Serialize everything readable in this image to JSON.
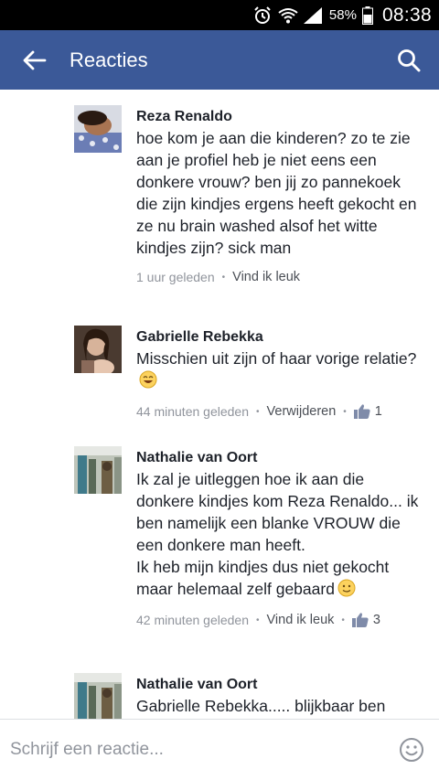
{
  "status_bar": {
    "battery": "58%",
    "time": "08:38"
  },
  "app_bar": {
    "title": "Reacties"
  },
  "comments": [
    {
      "author": "Reza Renaldo",
      "text": "hoe kom je aan die kinderen? zo te zie  aan je profiel heb je niet eens een donkere vrouw? ben jij zo pannekoek die zijn kindjes ergens heeft gekocht en ze nu brain washed alsof het witte kindjes zijn? sick man",
      "time": "1 uur geleden",
      "action": "Vind ik leuk",
      "likes": ""
    },
    {
      "author": "Gabrielle Rebekka",
      "text": "Misschien uit zijn of haar vorige relatie?",
      "time": "44 minuten geleden",
      "action": "Verwijderen",
      "likes": "1"
    },
    {
      "author": "Nathalie van Oort",
      "text": "Ik zal je uitleggen hoe ik aan die donkere kindjes kom Reza Renaldo... ik ben namelijk een blanke VROUW die een donkere man heeft.\nIk heb mijn kindjes dus niet gekocht maar helemaal zelf gebaard",
      "time": "42 minuten geleden",
      "action": "Vind ik leuk",
      "likes": "3"
    },
    {
      "author": "Nathalie van Oort",
      "text": "Gabrielle Rebekka..... blijkbaar ben",
      "time": "",
      "action": "",
      "likes": ""
    }
  ],
  "composer": {
    "placeholder": "Schrijf een reactie..."
  }
}
